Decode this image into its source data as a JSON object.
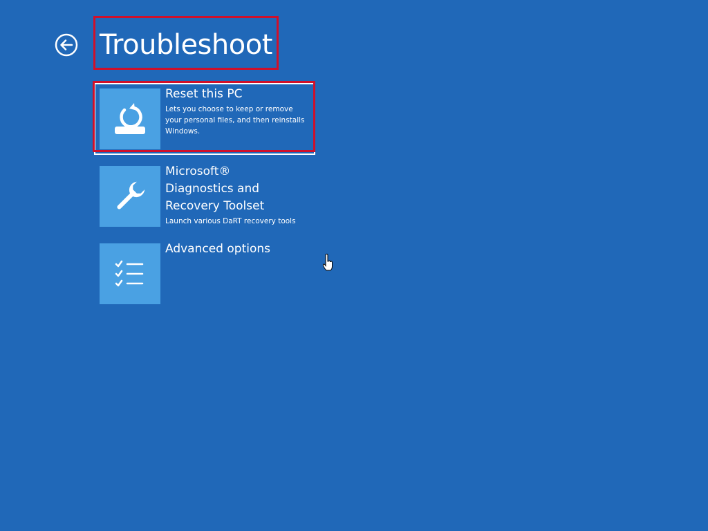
{
  "header": {
    "title": "Troubleshoot"
  },
  "icons": {
    "back": "back-arrow-circle-icon",
    "reset": "reset-pc-icon",
    "dart": "wrench-icon",
    "advanced": "checklist-icon",
    "cursor": "hand-pointer-icon"
  },
  "options": [
    {
      "title": "Reset this PC",
      "description": "Lets you choose to keep or remove your personal files, and then reinstalls Windows."
    },
    {
      "title": "Microsoft®\nDiagnostics and\nRecovery Toolset",
      "description": "Launch various DaRT recovery tools"
    },
    {
      "title": "Advanced options",
      "description": ""
    }
  ],
  "colors": {
    "background": "#2068b8",
    "tile": "#4aa1e3",
    "highlight": "#d0102a",
    "text": "#ffffff"
  }
}
